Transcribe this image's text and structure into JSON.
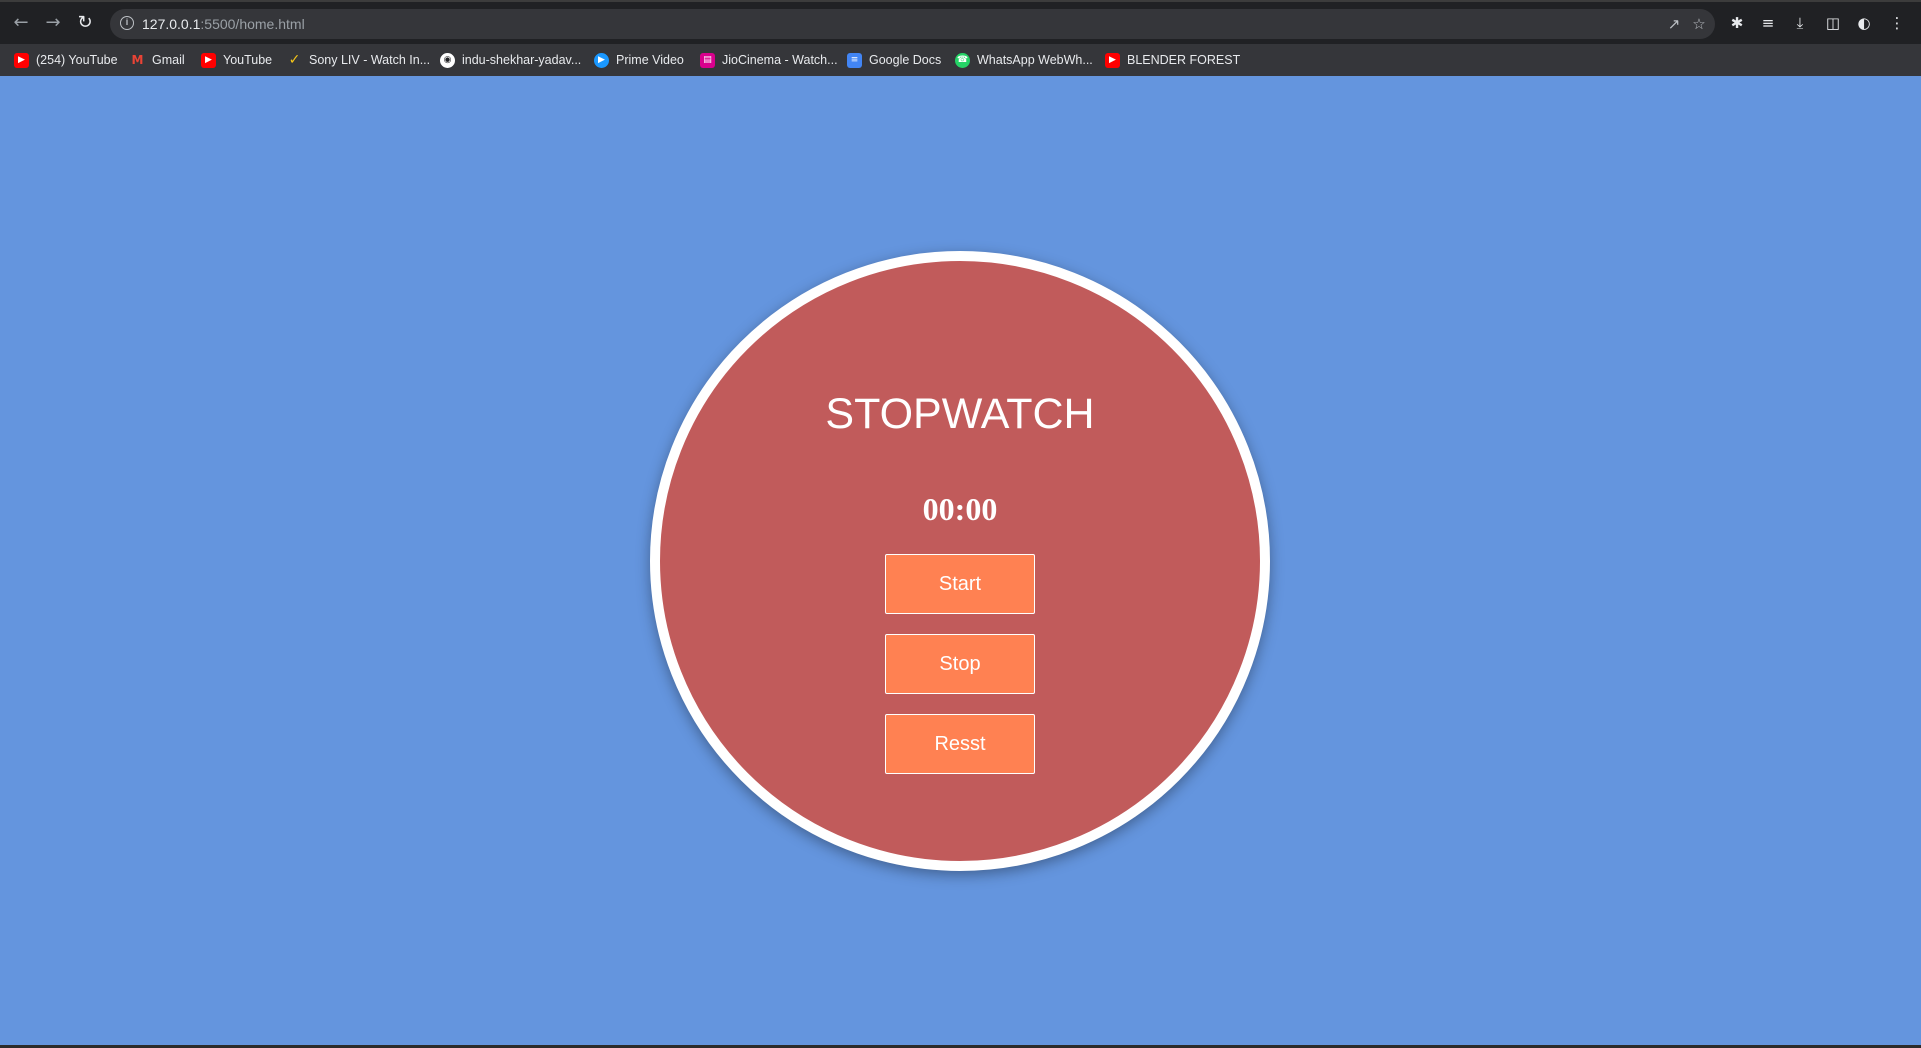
{
  "browser": {
    "url_host": "127.0.0.1",
    "url_rest": ":5500/home.html",
    "bookmarks": [
      {
        "label": "(254) YouTube",
        "icon": "youtube-icon",
        "color": "#ff0000"
      },
      {
        "label": "Gmail",
        "icon": "gmail-icon",
        "color": "#ea4335"
      },
      {
        "label": "YouTube",
        "icon": "youtube-icon",
        "color": "#ff0000"
      },
      {
        "label": "Sony LIV - Watch In...",
        "icon": "sonyliv-icon",
        "color": "#f5c518"
      },
      {
        "label": "indu-shekhar-yadav...",
        "icon": "github-icon",
        "color": "#ffffff"
      },
      {
        "label": "Prime Video",
        "icon": "prime-video-icon",
        "color": "#1a98ff"
      },
      {
        "label": "JioCinema - Watch...",
        "icon": "jiocinema-icon",
        "color": "#d9008d"
      },
      {
        "label": "Google Docs",
        "icon": "google-docs-icon",
        "color": "#4285f4"
      },
      {
        "label": "WhatsApp WebWh...",
        "icon": "whatsapp-icon",
        "color": "#25d366"
      },
      {
        "label": "BLENDER FOREST",
        "icon": "youtube-icon",
        "color": "#ff0000"
      }
    ]
  },
  "stopwatch": {
    "title": "STOPWATCH",
    "time": "00:00",
    "start_label": "Start",
    "stop_label": "Stop",
    "reset_label": "Resst"
  },
  "colors": {
    "page_background": "#6495de",
    "circle_fill": "#c15b5b",
    "button_fill": "#ff8152"
  }
}
